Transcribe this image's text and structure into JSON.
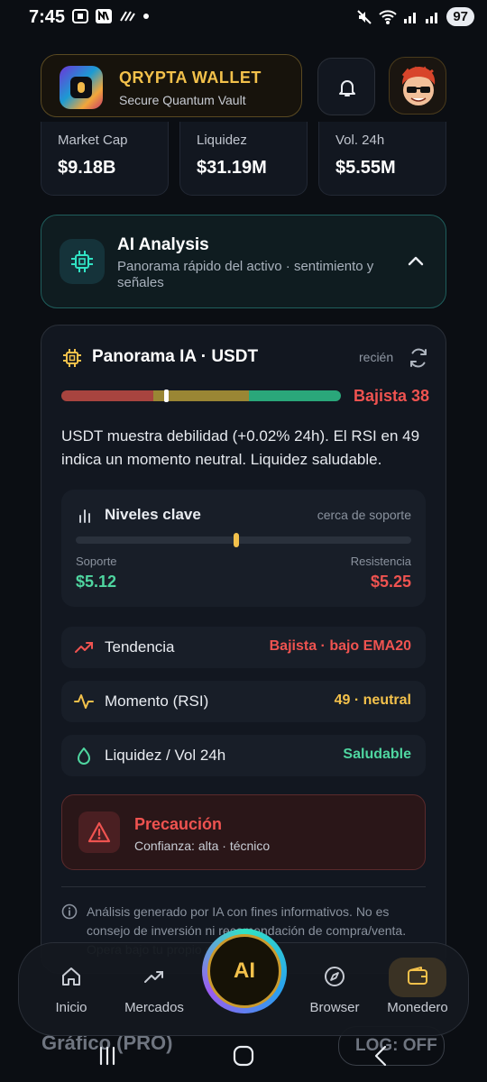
{
  "status": {
    "time": "7:45",
    "battery": "97"
  },
  "header": {
    "brand": "QRYPTA WALLET",
    "tagline": "Secure Quantum Vault"
  },
  "stats": [
    {
      "label": "Market Cap",
      "value": "$9.18B"
    },
    {
      "label": "Liquidez",
      "value": "$31.19M"
    },
    {
      "label": "Vol. 24h",
      "value": "$5.55M"
    }
  ],
  "ai_card": {
    "title": "AI Analysis",
    "subtitle": "Panorama rápido del activo · sentimiento y señales"
  },
  "panel": {
    "title": "Panorama IA · USDT",
    "timestamp": "recién",
    "sentiment_label": "Bajista 38",
    "sentiment_score": 38,
    "summary": "USDT muestra debilidad (+0.02% 24h). El RSI en 49 indica un momento neutral. Liquidez saludable.",
    "levels": {
      "title": "Niveles clave",
      "note": "cerca de soporte",
      "support_label": "Soporte",
      "support_value": "$5.12",
      "resistance_label": "Resistencia",
      "resistance_value": "$5.25",
      "position_fraction": 0.47
    },
    "rows": [
      {
        "label": "Tendencia",
        "value": "Bajista · bajo EMA20",
        "color": "#ef5350"
      },
      {
        "label": "Momento (RSI)",
        "value": "49 · neutral",
        "color": "#f3c14b"
      },
      {
        "label": "Liquidez / Vol 24h",
        "value": "Saludable",
        "color": "#4fd6a0"
      }
    ],
    "caution": {
      "title": "Precaución",
      "subtitle": "Confianza: alta · técnico"
    },
    "disclaimer": "Análisis generado por IA con fines informativos. No es consejo de inversión ni recomendación de compra/venta. Opera bajo tu propio riesgo."
  },
  "nav": {
    "items": [
      {
        "label": "Inicio"
      },
      {
        "label": "Mercados"
      },
      {
        "label": "Browser"
      },
      {
        "label": "Monedero"
      }
    ],
    "ai_label": "AI"
  },
  "underlay": {
    "left": "Gráfico (PRO)",
    "right": "LOG: OFF"
  },
  "colors": {
    "accent": "#f3c14b",
    "bearish": "#ef5350",
    "bullish": "#4fd6a0",
    "teal": "#31e3c4"
  }
}
